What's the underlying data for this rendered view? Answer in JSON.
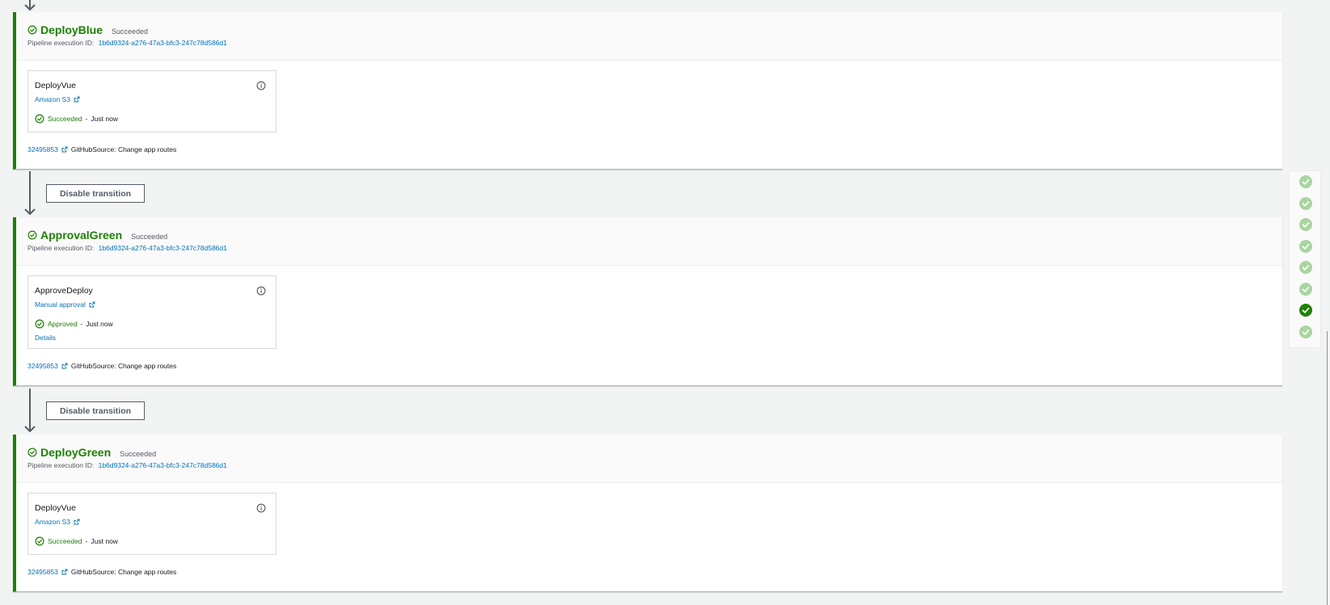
{
  "stages": [
    {
      "name": "DeployBlue",
      "status": "Succeeded",
      "exec_label": "Pipeline execution ID:",
      "exec_id": "1b6d9324-a276-47a3-bfc3-247c78d586d1",
      "action": {
        "name": "DeployVue",
        "provider": "Amazon S3",
        "status": "Succeeded",
        "sep": "-",
        "time": "Just now"
      },
      "commit_id": "32495853",
      "commit_msg": "GitHubSource: Change app routes"
    },
    {
      "name": "ApprovalGreen",
      "status": "Succeeded",
      "exec_label": "Pipeline execution ID:",
      "exec_id": "1b6d9324-a276-47a3-bfc3-247c78d586d1",
      "action": {
        "name": "ApproveDeploy",
        "provider": "Manual approval",
        "status": "Approved",
        "sep": "-",
        "time": "Just now",
        "details": "Details"
      },
      "commit_id": "32495853",
      "commit_msg": "GitHubSource: Change app routes"
    },
    {
      "name": "DeployGreen",
      "status": "Succeeded",
      "exec_label": "Pipeline execution ID:",
      "exec_id": "1b6d9324-a276-47a3-bfc3-247c78d586d1",
      "action": {
        "name": "DeployVue",
        "provider": "Amazon S3",
        "status": "Succeeded",
        "sep": "-",
        "time": "Just now"
      },
      "commit_id": "32495853",
      "commit_msg": "GitHubSource: Change app routes"
    }
  ],
  "transitions": [
    {
      "label": "Disable transition"
    },
    {
      "label": "Disable transition"
    }
  ],
  "minimap": {
    "items": [
      "stage-1",
      "stage-2",
      "stage-3",
      "stage-4",
      "stage-5",
      "stage-6",
      "stage-7",
      "stage-8"
    ],
    "active_index": 6
  },
  "colors": {
    "success": "#1d8102",
    "success_light": "#a8d5a0",
    "link": "#0073bb"
  }
}
